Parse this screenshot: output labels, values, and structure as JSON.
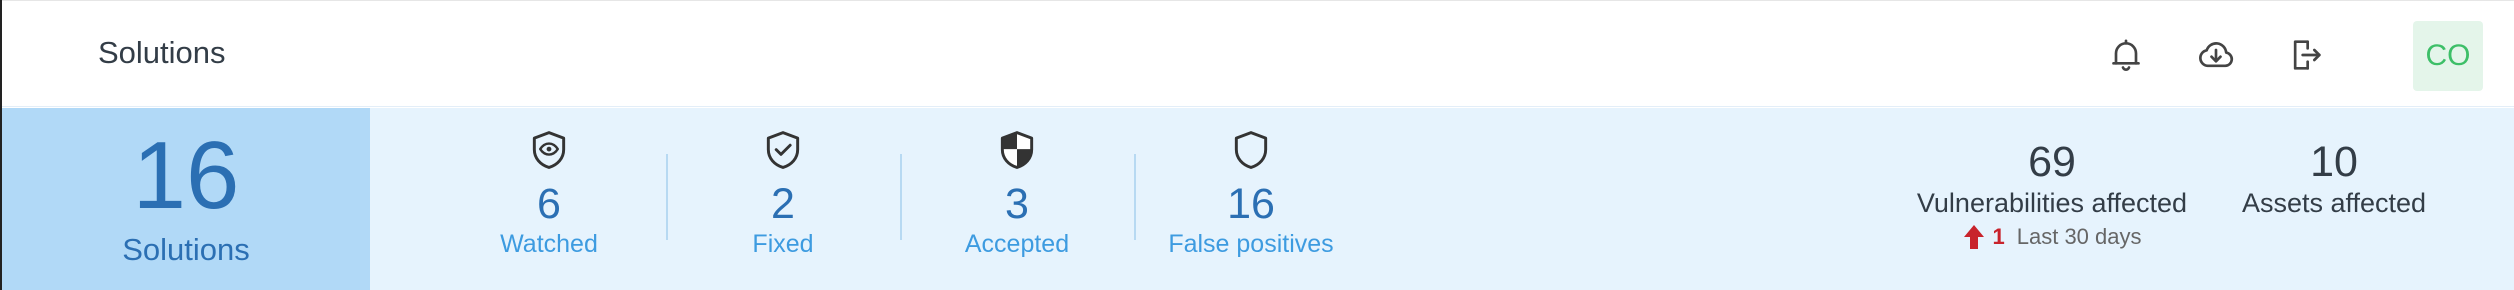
{
  "header": {
    "title": "Solutions",
    "icons": [
      "bell-icon",
      "cloud-download-icon",
      "logout-icon"
    ],
    "avatar_initials": "CO"
  },
  "summary": {
    "total": {
      "value": "16",
      "label": "Solutions"
    },
    "statuses": [
      {
        "icon": "shield-eye-icon",
        "value": "6",
        "label": "Watched"
      },
      {
        "icon": "shield-check-icon",
        "value": "2",
        "label": "Fixed"
      },
      {
        "icon": "shield-half-icon",
        "value": "3",
        "label": "Accepted"
      },
      {
        "icon": "shield-outline-icon",
        "value": "16",
        "label": "False positives"
      }
    ],
    "vulnerabilities": {
      "value": "69",
      "label": "Vulnerabilities affected",
      "trend_value": "1",
      "trend_period": "Last 30 days",
      "trend_direction": "up"
    },
    "assets": {
      "value": "10",
      "label": "Assets affected"
    }
  },
  "colors": {
    "accent": "#2b6fb3",
    "link": "#3d9be0",
    "stats_background": "#e6f3fd",
    "total_background": "#b1d9f7",
    "trend_up": "#c8232c",
    "avatar_bg": "#e4f5ea",
    "avatar_text": "#3dbf68"
  }
}
